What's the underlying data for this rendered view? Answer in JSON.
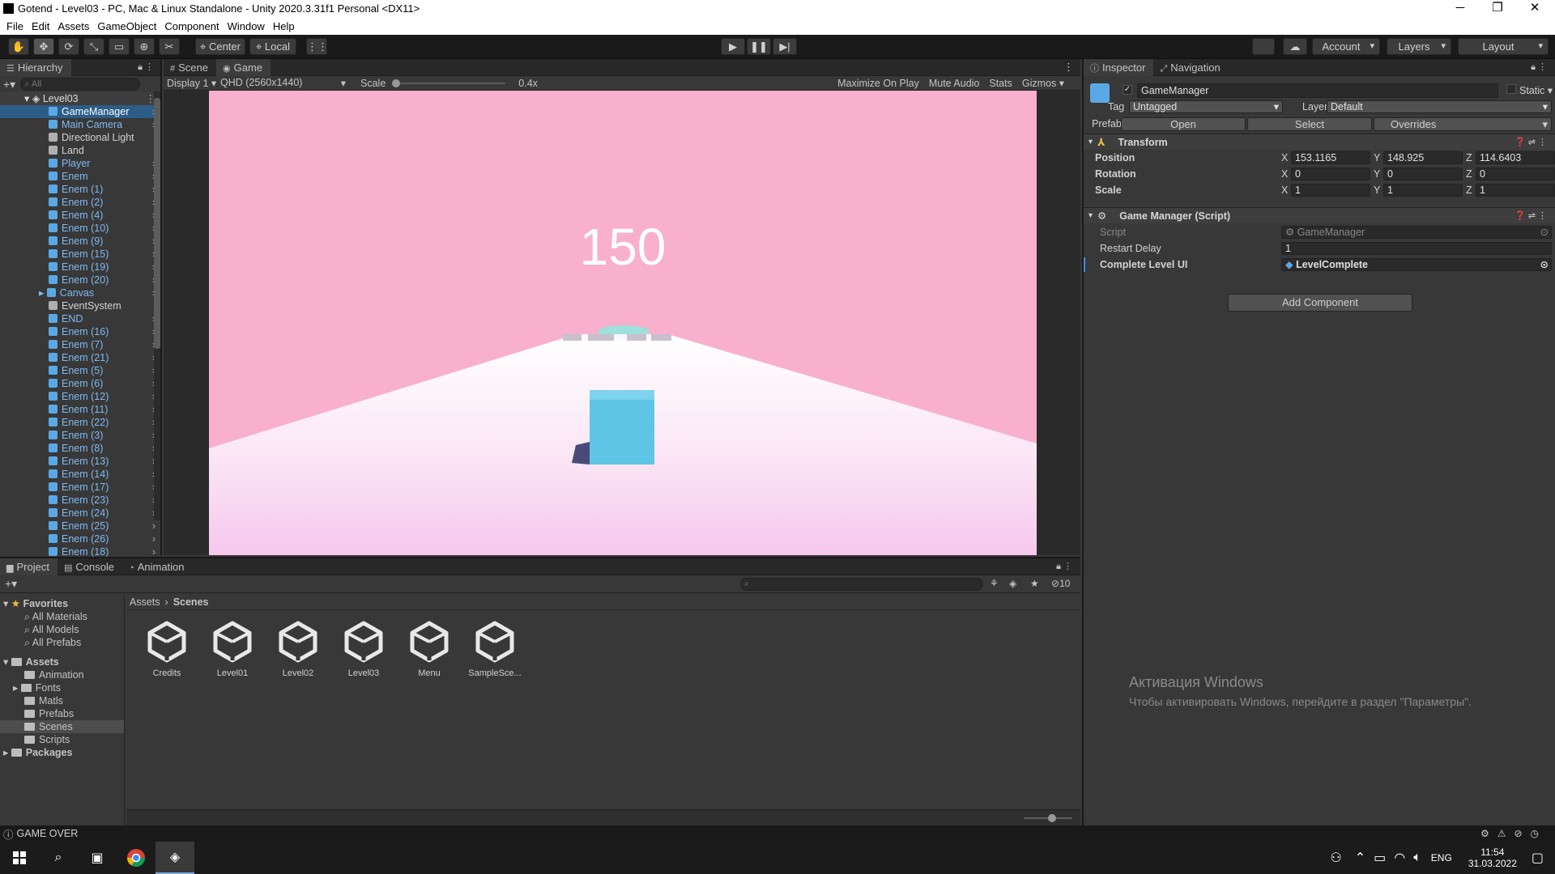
{
  "window": {
    "title": "Gotend - Level03 - PC, Mac & Linux Standalone - Unity 2020.3.31f1 Personal <DX11>",
    "controls": {
      "minimize": "─",
      "maximize": "❐",
      "close": "✕"
    }
  },
  "menu": [
    "File",
    "Edit",
    "Assets",
    "GameObject",
    "Component",
    "Window",
    "Help"
  ],
  "toolbar": {
    "pivot": "Center",
    "space": "Local",
    "account": "Account",
    "layers": "Layers",
    "layout": "Layout"
  },
  "hierarchy": {
    "tab": "Hierarchy",
    "search_placeholder": "All",
    "scene": "Level03",
    "items": [
      {
        "label": "GameManager",
        "prefab": true,
        "selected": true,
        "chevron": true
      },
      {
        "label": "Main Camera",
        "prefab": true,
        "chevron": true
      },
      {
        "label": "Directional Light",
        "prefab": false,
        "chevron": false
      },
      {
        "label": "Land",
        "prefab": false,
        "chevron": false
      },
      {
        "label": "Player",
        "prefab": true,
        "chevron": true
      },
      {
        "label": "Enem",
        "prefab": true,
        "chevron": true
      },
      {
        "label": "Enem (1)",
        "prefab": true,
        "chevron": true
      },
      {
        "label": "Enem (2)",
        "prefab": true,
        "chevron": true
      },
      {
        "label": "Enem (4)",
        "prefab": true,
        "chevron": true
      },
      {
        "label": "Enem (10)",
        "prefab": true,
        "chevron": true
      },
      {
        "label": "Enem (9)",
        "prefab": true,
        "chevron": true
      },
      {
        "label": "Enem (15)",
        "prefab": true,
        "chevron": true
      },
      {
        "label": "Enem (19)",
        "prefab": true,
        "chevron": true
      },
      {
        "label": "Enem (20)",
        "prefab": true,
        "chevron": true
      },
      {
        "label": "Canvas",
        "prefab": true,
        "chevron": true,
        "expand": true
      },
      {
        "label": "EventSystem",
        "prefab": false,
        "chevron": false
      },
      {
        "label": "END",
        "prefab": true,
        "chevron": true
      },
      {
        "label": "Enem (16)",
        "prefab": true,
        "chevron": true
      },
      {
        "label": "Enem (7)",
        "prefab": true,
        "chevron": true
      },
      {
        "label": "Enem (21)",
        "prefab": true,
        "chevron": true
      },
      {
        "label": "Enem (5)",
        "prefab": true,
        "chevron": true
      },
      {
        "label": "Enem (6)",
        "prefab": true,
        "chevron": true
      },
      {
        "label": "Enem (12)",
        "prefab": true,
        "chevron": true
      },
      {
        "label": "Enem (11)",
        "prefab": true,
        "chevron": true
      },
      {
        "label": "Enem (22)",
        "prefab": true,
        "chevron": true
      },
      {
        "label": "Enem (3)",
        "prefab": true,
        "chevron": true
      },
      {
        "label": "Enem (8)",
        "prefab": true,
        "chevron": true
      },
      {
        "label": "Enem (13)",
        "prefab": true,
        "chevron": true
      },
      {
        "label": "Enem (14)",
        "prefab": true,
        "chevron": true
      },
      {
        "label": "Enem (17)",
        "prefab": true,
        "chevron": true
      },
      {
        "label": "Enem (23)",
        "prefab": true,
        "chevron": true
      },
      {
        "label": "Enem (24)",
        "prefab": true,
        "chevron": true
      },
      {
        "label": "Enem (25)",
        "prefab": true,
        "chevron": true
      },
      {
        "label": "Enem (26)",
        "prefab": true,
        "chevron": true
      },
      {
        "label": "Enem (18)",
        "prefab": true,
        "chevron": true
      }
    ]
  },
  "game": {
    "tabs": [
      "Scene",
      "Game"
    ],
    "display": "Display 1",
    "resolution": "QHD (2560x1440)",
    "scale_label": "Scale",
    "scale_value": "0.4x",
    "buttons": [
      "Maximize On Play",
      "Mute Audio",
      "Stats",
      "Gizmos"
    ],
    "score": "150",
    "colors": {
      "sky": "#f8b0cc",
      "ground_top": "#ffffff",
      "ground_bottom": "#f6c8ee",
      "player": "#5ec5e6"
    }
  },
  "inspector": {
    "tabs": [
      "Inspector",
      "Navigation"
    ],
    "object_name": "GameManager",
    "static_label": "Static",
    "tag_label": "Tag",
    "tag_value": "Untagged",
    "layer_label": "Layer",
    "layer_value": "Default",
    "prefab_label": "Prefab",
    "prefab_open": "Open",
    "prefab_select": "Select",
    "prefab_overrides": "Overrides",
    "transform": {
      "title": "Transform",
      "rows": [
        {
          "label": "Position",
          "x": "153.1165",
          "y": "148.925",
          "z": "114.6403"
        },
        {
          "label": "Rotation",
          "x": "0",
          "y": "0",
          "z": "0"
        },
        {
          "label": "Scale",
          "x": "1",
          "y": "1",
          "z": "1"
        }
      ]
    },
    "script_component": {
      "title": "Game Manager (Script)",
      "script_label": "Script",
      "script_value": "GameManager",
      "restart_label": "Restart Delay",
      "restart_value": "1",
      "complete_label": "Complete Level UI",
      "complete_value": "LevelComplete"
    },
    "add_component": "Add Component",
    "watermark_title": "Активация Windows",
    "watermark_text": "Чтобы активировать Windows, перейдите в раздел \"Параметры\"."
  },
  "project": {
    "tabs": [
      "Project",
      "Console",
      "Animation"
    ],
    "hidden_count": "10",
    "breadcrumb": [
      "Assets",
      "Scenes"
    ],
    "favorites_label": "Favorites",
    "favorites": [
      "All Materials",
      "All Models",
      "All Prefabs"
    ],
    "assets_label": "Assets",
    "asset_folders": [
      "Animation",
      "Fonts",
      "Matls",
      "Prefabs",
      "Scenes",
      "Scripts"
    ],
    "packages_label": "Packages",
    "files": [
      "Credits",
      "Level01",
      "Level02",
      "Level03",
      "Menu",
      "SampleSce..."
    ]
  },
  "status": {
    "message": "GAME OVER"
  },
  "taskbar": {
    "lang": "ENG",
    "time": "11:54",
    "date": "31.03.2022"
  }
}
